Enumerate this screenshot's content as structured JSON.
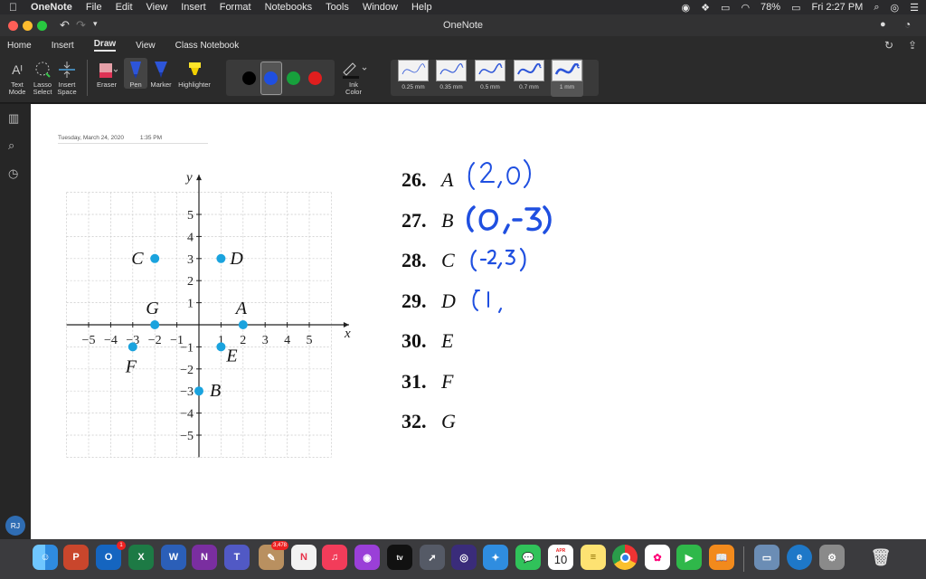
{
  "menubar": {
    "app": "OneNote",
    "items": [
      "File",
      "Edit",
      "View",
      "Insert",
      "Format",
      "Notebooks",
      "Tools",
      "Window",
      "Help"
    ],
    "battery": "78%",
    "clock": "Fri 2:27 PM"
  },
  "window": {
    "title": "OneNote"
  },
  "ribbon": {
    "tabs": [
      "Home",
      "Insert",
      "Draw",
      "View",
      "Class Notebook"
    ],
    "active_tab": "Draw",
    "tools": {
      "text_mode": "Text Mode",
      "lasso_select": "Lasso Select",
      "insert_space": "Insert Space",
      "eraser": "Eraser",
      "pen": "Pen",
      "marker": "Marker",
      "highlighter": "Highlighter",
      "ink_color": "Ink Color"
    },
    "colors": [
      {
        "name": "black",
        "hex": "#000000"
      },
      {
        "name": "blue",
        "hex": "#1f4fe0"
      },
      {
        "name": "green",
        "hex": "#17a03c"
      },
      {
        "name": "red",
        "hex": "#e01e1e"
      }
    ],
    "selected_color": "blue",
    "thicknesses": [
      "0.25 mm",
      "0.35 mm",
      "0.5 mm",
      "0.7 mm",
      "1 mm"
    ],
    "selected_thickness": "1 mm"
  },
  "sidebar": {
    "avatar_initials": "RJ"
  },
  "page": {
    "date": "Tuesday, March 24, 2020",
    "time": "1:35 PM",
    "graph": {
      "axis_x": "x",
      "axis_y": "y",
      "x_ticks": [
        "−5",
        "−4",
        "−3",
        "−2",
        "−1",
        "1",
        "2",
        "3",
        "4",
        "5"
      ],
      "y_ticks": [
        "5",
        "4",
        "3",
        "2",
        "1",
        "−1",
        "−2",
        "−3",
        "−4",
        "−5"
      ],
      "points": [
        {
          "label": "A",
          "x": 2,
          "y": 0
        },
        {
          "label": "B",
          "x": 0,
          "y": -3
        },
        {
          "label": "C",
          "x": -2,
          "y": 3
        },
        {
          "label": "D",
          "x": 1,
          "y": 3
        },
        {
          "label": "E",
          "x": 1,
          "y": -1
        },
        {
          "label": "F",
          "x": -3,
          "y": -1
        },
        {
          "label": "G",
          "x": -2,
          "y": 0
        }
      ],
      "point_color": "#1aa3de"
    },
    "problems": [
      {
        "num": "26.",
        "letter": "A",
        "answer": "(2,0)"
      },
      {
        "num": "27.",
        "letter": "B",
        "answer": "(0,-3)"
      },
      {
        "num": "28.",
        "letter": "C",
        "answer": "(-2,3)"
      },
      {
        "num": "29.",
        "letter": "D",
        "answer": "(1,"
      },
      {
        "num": "30.",
        "letter": "E",
        "answer": ""
      },
      {
        "num": "31.",
        "letter": "F",
        "answer": ""
      },
      {
        "num": "32.",
        "letter": "G",
        "answer": ""
      }
    ],
    "ink_color": "#1f4fe0"
  },
  "dock": {
    "outlook_badge": "1",
    "photos_badge": "3,478",
    "calendar_month": "APR",
    "calendar_day": "10"
  }
}
